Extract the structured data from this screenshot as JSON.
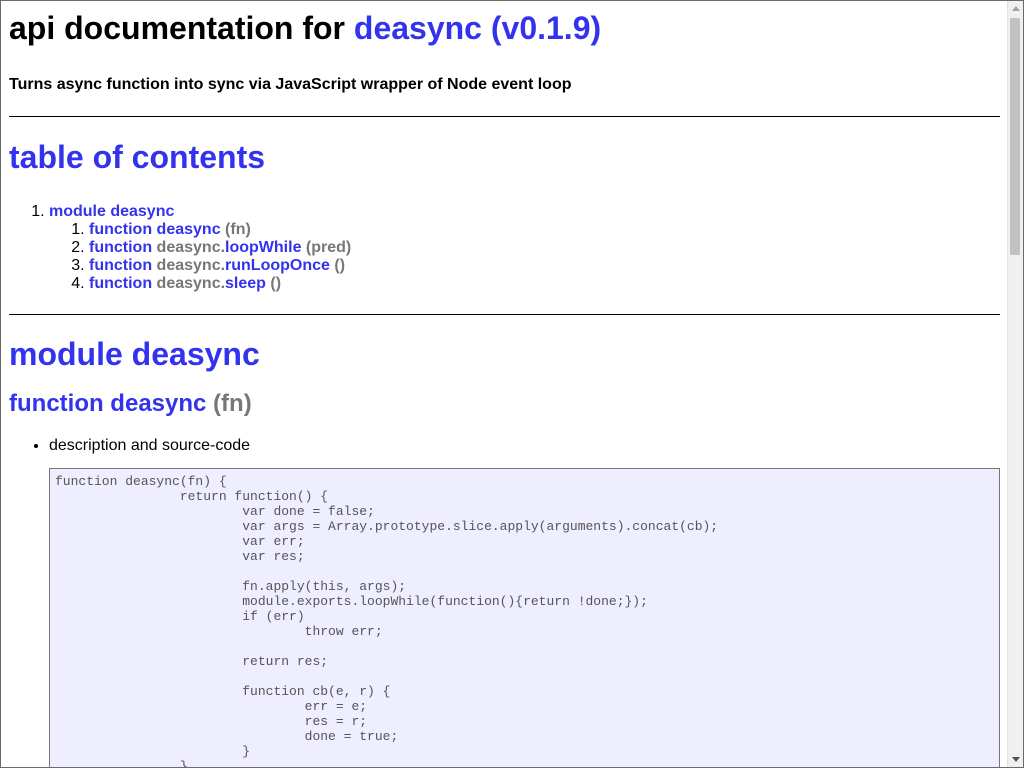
{
  "header": {
    "title_prefix": "api documentation for",
    "title_link": "deasync (v0.1.9)",
    "subtitle": "Turns async function into sync via JavaScript wrapper of Node event loop"
  },
  "toc": {
    "title": "table of contents",
    "module": {
      "label": "module deasync"
    },
    "items": [
      {
        "keyword": "function",
        "prefix": "",
        "name": "deasync",
        "args": "(fn)"
      },
      {
        "keyword": "function",
        "prefix": "deasync.",
        "name": "loopWhile",
        "args": "(pred)"
      },
      {
        "keyword": "function",
        "prefix": "deasync.",
        "name": "runLoopOnce",
        "args": "()"
      },
      {
        "keyword": "function",
        "prefix": "deasync.",
        "name": "sleep",
        "args": "()"
      }
    ]
  },
  "module_section": {
    "title": "module deasync",
    "function_title": "function deasync",
    "function_args": "(fn)",
    "bullet": "description and source-code",
    "code": "function deasync(fn) {\n\t\treturn function() {\n\t\t\tvar done = false;\n\t\t\tvar args = Array.prototype.slice.apply(arguments).concat(cb);\n\t\t\tvar err;\n\t\t\tvar res;\n\n\t\t\tfn.apply(this, args);\n\t\t\tmodule.exports.loopWhile(function(){return !done;});\n\t\t\tif (err)\n\t\t\t\tthrow err;\n\n\t\t\treturn res;\n\n\t\t\tfunction cb(e, r) {\n\t\t\t\terr = e;\n\t\t\t\tres = r;\n\t\t\t\tdone = true;\n\t\t\t}\n\t\t}\n\t}"
  },
  "colors": {
    "link": "#3333ee",
    "muted": "#777777",
    "code_bg": "#eeeeff"
  }
}
